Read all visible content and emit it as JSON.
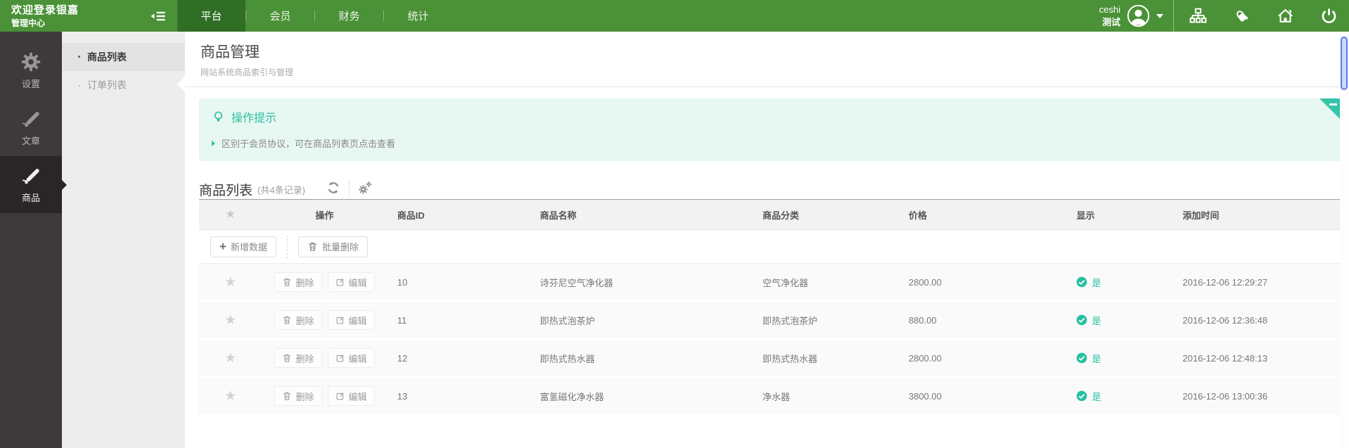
{
  "brand": {
    "title": "欢迎登录银嘉",
    "subtitle": "管理中心"
  },
  "topnav": {
    "items": [
      {
        "label": "平台",
        "active": true
      },
      {
        "label": "会员",
        "active": false
      },
      {
        "label": "财务",
        "active": false
      },
      {
        "label": "统计",
        "active": false
      }
    ],
    "user": {
      "line1": "ceshi",
      "line2": "测试"
    },
    "icons": [
      "sitemap-icon",
      "paint-icon",
      "home-icon",
      "power-icon"
    ]
  },
  "sidebar": {
    "items": [
      {
        "label": "设置",
        "icon": "gear",
        "active": false
      },
      {
        "label": "文章",
        "icon": "pen",
        "active": false
      },
      {
        "label": "商品",
        "icon": "pen",
        "active": true
      }
    ]
  },
  "submenu": {
    "items": [
      {
        "label": "商品列表",
        "active": true
      },
      {
        "label": "订单列表",
        "active": false
      }
    ]
  },
  "page": {
    "title": "商品管理",
    "subtitle": "网站系统商品索引与管理"
  },
  "tips": {
    "title": "操作提示",
    "lines": [
      "区别于会员协议，可在商品列表页点击查看"
    ]
  },
  "table": {
    "title": "商品列表",
    "count_label": "(共4条记录)",
    "columns": [
      "操作",
      "商品ID",
      "商品名称",
      "商品分类",
      "价格",
      "显示",
      "添加时间"
    ],
    "toolbar": {
      "add_label": "新增数据",
      "batch_delete_label": "批量删除"
    },
    "row_actions": {
      "delete_label": "删除",
      "edit_label": "编辑"
    },
    "rows": [
      {
        "id": "10",
        "name": "诗芬尼空气净化器",
        "category": "空气净化器",
        "price": "2800.00",
        "visible": "是",
        "created": "2016-12-06 12:29:27"
      },
      {
        "id": "11",
        "name": "即热式泡茶炉",
        "category": "即热式泡茶炉",
        "price": "880.00",
        "visible": "是",
        "created": "2016-12-06 12:36:48"
      },
      {
        "id": "12",
        "name": "即热式热水器",
        "category": "即热式热水器",
        "price": "2800.00",
        "visible": "是",
        "created": "2016-12-06 12:48:13"
      },
      {
        "id": "13",
        "name": "富氢磁化净水器",
        "category": "净水器",
        "price": "3800.00",
        "visible": "是",
        "created": "2016-12-06 13:00:36"
      }
    ]
  },
  "colors": {
    "header_green": "#4a9137",
    "header_green_active": "#2f6e24",
    "sidebar_dark": "#3e3a3b",
    "sidebar_active": "#2a2627",
    "accent_teal": "#26c0a1",
    "tips_bg": "#e7f7f1",
    "scroll_thumb": "#cdd9f8",
    "scroll_thumb_border": "#5d7ae8"
  }
}
